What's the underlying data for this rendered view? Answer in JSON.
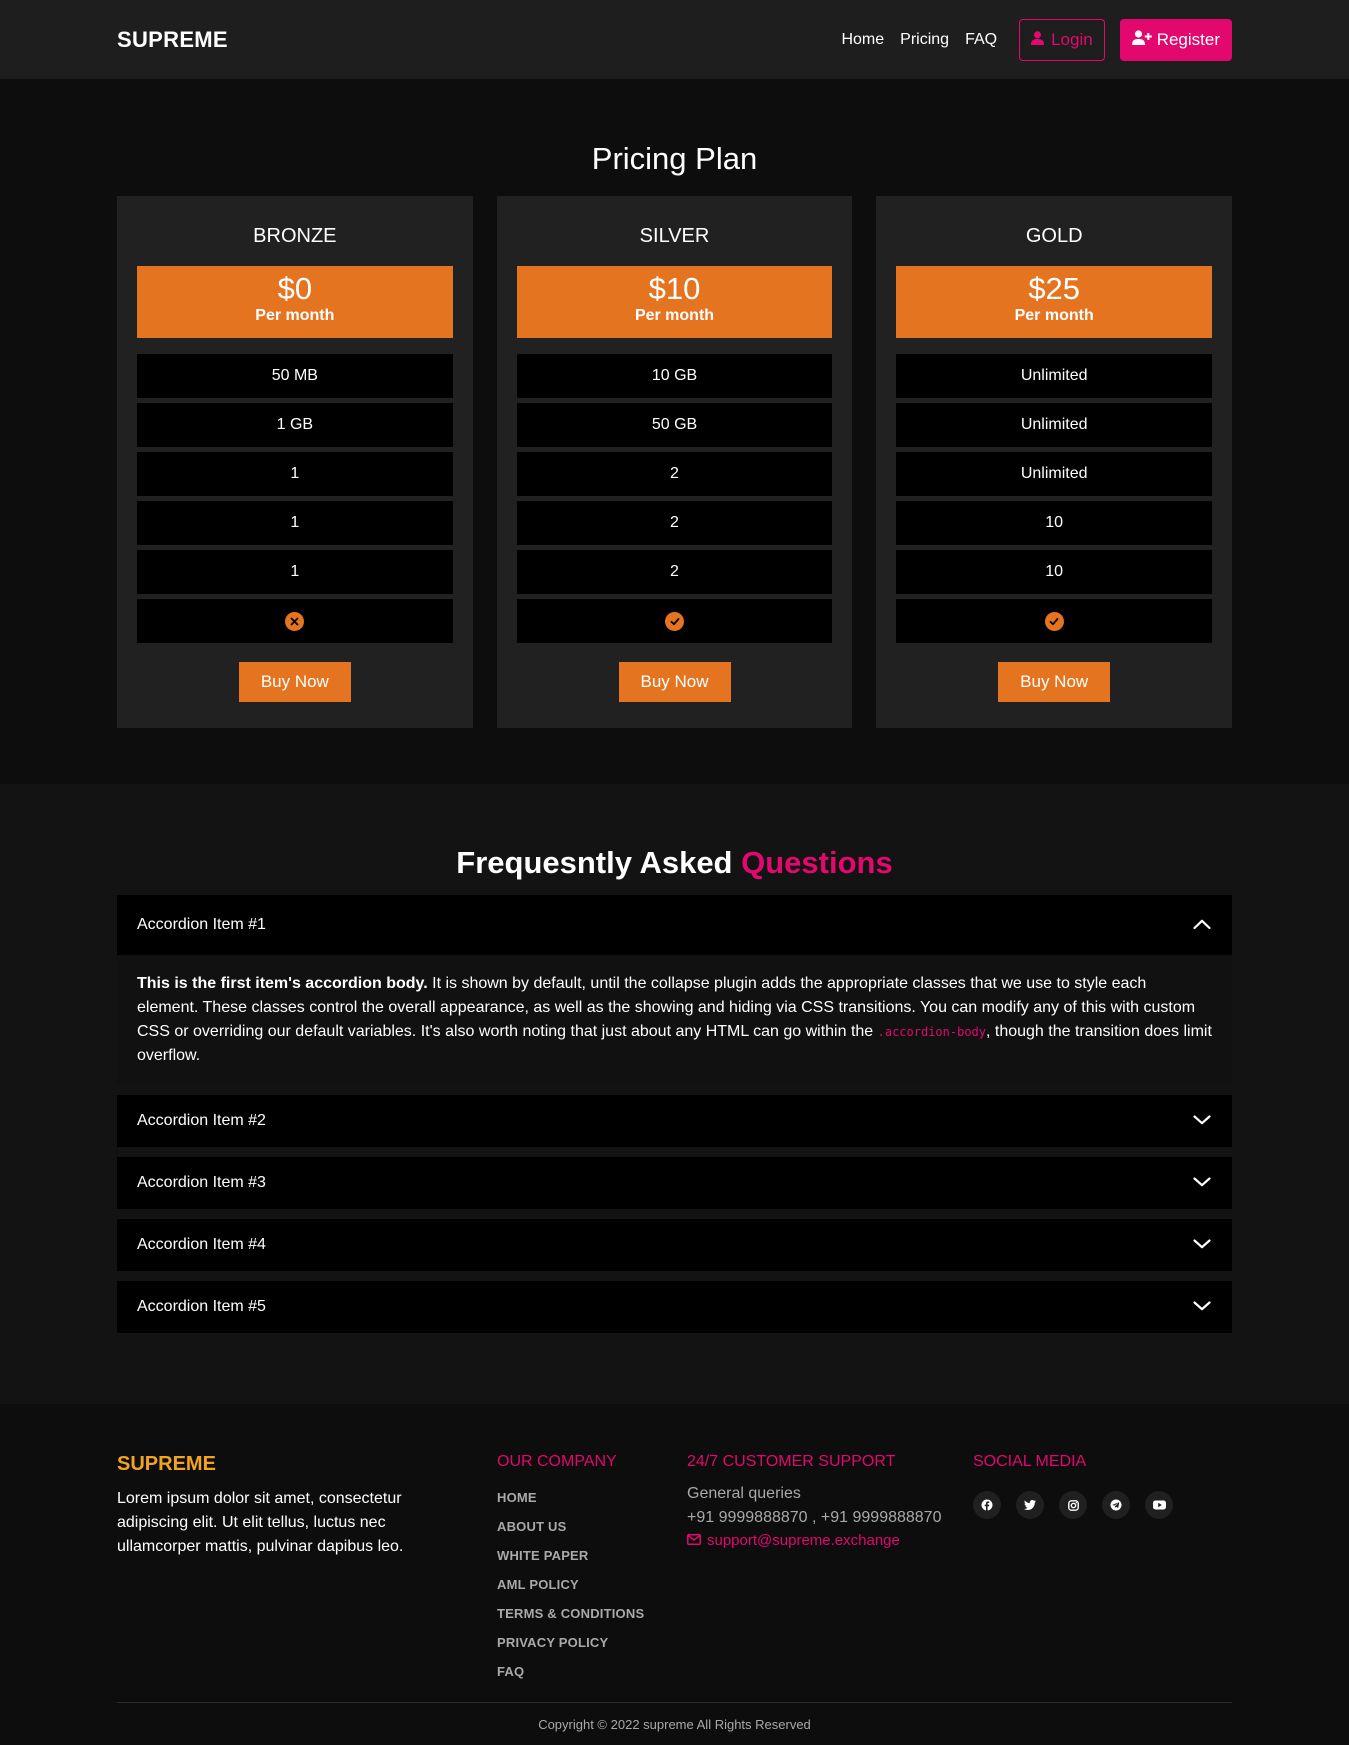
{
  "nav": {
    "brand": "SUPREME",
    "links": [
      "Home",
      "Pricing",
      "FAQ"
    ],
    "login": "Login",
    "register": "Register"
  },
  "pricing": {
    "title": "Pricing Plan",
    "plans": [
      {
        "name": "BRONZE",
        "price": "$0",
        "period": "Per month",
        "features": [
          "50 MB",
          "1 GB",
          "1",
          "1",
          "1"
        ],
        "status": "x-circle-icon",
        "button": "Buy Now"
      },
      {
        "name": "SILVER",
        "price": "$10",
        "period": "Per month",
        "features": [
          "10 GB",
          "50 GB",
          "2",
          "2",
          "2"
        ],
        "status": "check-circle-icon",
        "button": "Buy Now"
      },
      {
        "name": "GOLD",
        "price": "$25",
        "period": "Per month",
        "features": [
          "Unlimited",
          "Unlimited",
          "Unlimited",
          "10",
          "10"
        ],
        "status": "check-circle-icon",
        "button": "Buy Now"
      }
    ]
  },
  "faq": {
    "title_main": "Frequesntly Asked",
    "title_accent": "Questions",
    "items": [
      {
        "title": "Accordion Item #1",
        "expanded": true
      },
      {
        "title": "Accordion Item #2",
        "expanded": false
      },
      {
        "title": "Accordion Item #3",
        "expanded": false
      },
      {
        "title": "Accordion Item #4",
        "expanded": false
      },
      {
        "title": "Accordion Item #5",
        "expanded": false
      }
    ],
    "body_strong": "This is the first item's accordion body.",
    "body_text_1": " It is shown by default, until the collapse plugin adds the appropriate classes that we use to style each element. These classes control the overall appearance, as well as the showing and hiding via CSS transitions. You can modify any of this with custom CSS or overriding our default variables. It's also worth noting that just about any HTML can go within the ",
    "body_code": ".accordion-body",
    "body_text_2": ", though the transition does limit overflow."
  },
  "footer": {
    "brand": "SUPREME",
    "description": "Lorem ipsum dolor sit amet, consectetur adipiscing elit. Ut elit tellus, luctus nec ullamcorper mattis, pulvinar dapibus leo.",
    "company_heading": "OUR COMPANY",
    "company_links": [
      "HOME",
      "ABOUT US",
      "WHITE PAPER",
      "AML POLICY",
      "TERMS & CONDITIONS",
      "PRIVACY POLICY",
      "FAQ"
    ],
    "support_heading": "24/7 CUSTOMER SUPPORT",
    "support_label": "General queries",
    "support_phones": "+91 9999888870 , +91 9999888870",
    "support_email": "support@supreme.exchange",
    "social_heading": "SOCIAL MEDIA",
    "social_icons": [
      "facebook-icon",
      "twitter-icon",
      "instagram-icon",
      "telegram-icon",
      "youtube-icon"
    ],
    "copyright": "Copyright © 2022 supreme All Rights Reserved"
  },
  "colors": {
    "accent_pink": "#e2086e",
    "accent_orange": "#e57421",
    "brand_gold": "#f4a31f"
  }
}
